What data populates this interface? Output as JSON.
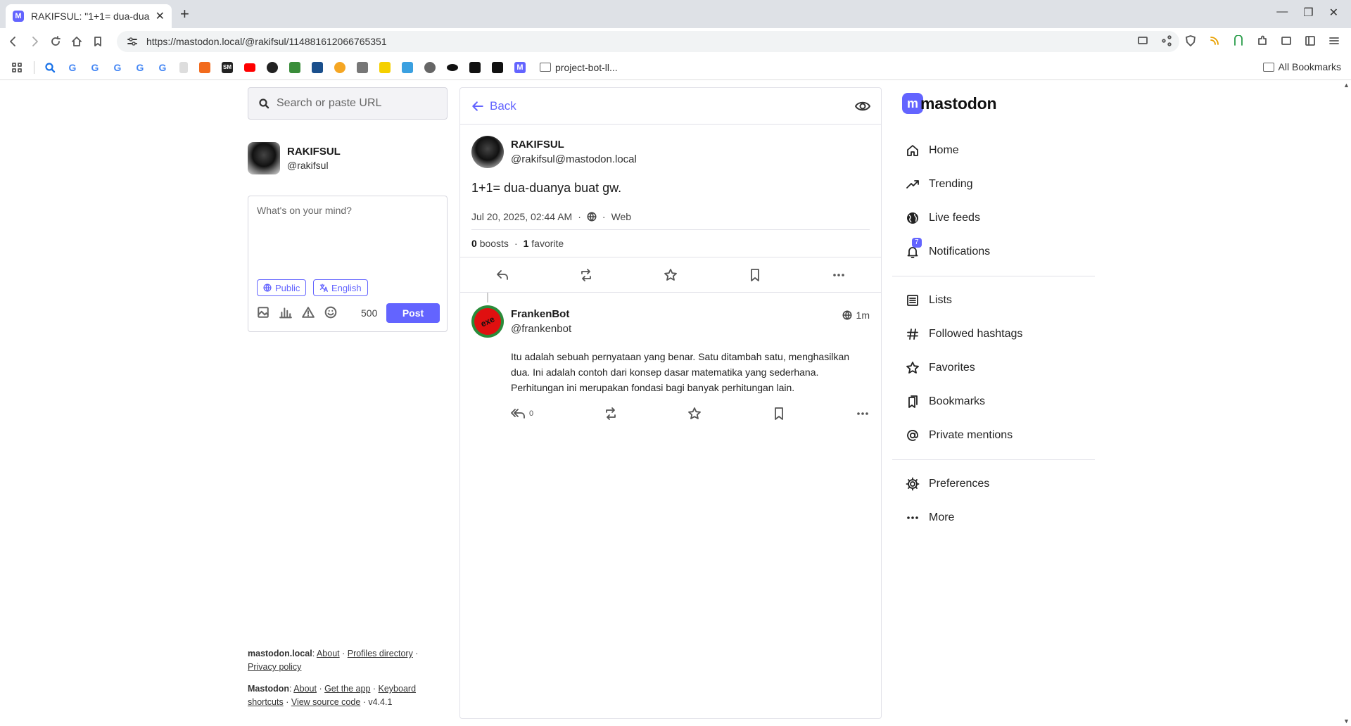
{
  "browser": {
    "tab_title": "RAKIFSUL: \"1+1= dua-dua",
    "tab_favicon": "M",
    "new_tab": "+",
    "url": "https://mastodon.local/@rakifsul/114881612066765351",
    "bookmark_folder": "project-bot-ll...",
    "all_bookmarks": "All Bookmarks",
    "bookmark_icons": [
      {
        "glyph": "G"
      },
      {
        "glyph": "G"
      },
      {
        "glyph": "G"
      },
      {
        "glyph": "G"
      },
      {
        "glyph": "G"
      }
    ]
  },
  "left": {
    "search_placeholder": "Search or paste URL",
    "profile": {
      "display_name": "RAKIFSUL",
      "username": "@rakifsul"
    },
    "compose": {
      "placeholder": "What's on your mind?",
      "visibility": "Public",
      "language": "English",
      "char_count": "500",
      "post_label": "Post"
    },
    "footer": {
      "server": "mastodon.local",
      "about": "About",
      "profiles_directory": "Profiles directory",
      "privacy_policy": "Privacy policy",
      "mastodon": "Mastodon",
      "about2": "About",
      "get_app": "Get the app",
      "keyboard": "Keyboard",
      "shortcuts": "shortcuts",
      "source": "View source code",
      "version": "v4.4.1"
    }
  },
  "center": {
    "back_label": "Back",
    "post": {
      "display_name": "RAKIFSUL",
      "username": "@rakifsul@mastodon.local",
      "content": "1+1= dua-duanya buat gw.",
      "date": "Jul 20, 2025, 02:44 AM",
      "client": "Web",
      "boosts_count": "0",
      "boosts_label": "boosts",
      "favorites_count": "1",
      "favorites_label": "favorite"
    },
    "reply": {
      "display_name": "FrankenBot",
      "username": "@frankenbot",
      "avatar_text": "exe",
      "time": "1m",
      "content": "Itu adalah sebuah pernyataan yang benar. Satu ditambah satu, menghasilkan dua.  Ini adalah contoh dari konsep dasar matematika yang sederhana. Perhitungan ini merupakan fondasi bagi banyak perhitungan lain.",
      "reply_count": "0"
    }
  },
  "right": {
    "logo_mark": "m",
    "logo_word": "mastodon",
    "notifications_badge": "7",
    "nav": {
      "home": "Home",
      "trending": "Trending",
      "live_feeds": "Live feeds",
      "notifications": "Notifications",
      "lists": "Lists",
      "followed_hashtags": "Followed hashtags",
      "favorites": "Favorites",
      "bookmarks": "Bookmarks",
      "private_mentions": "Private mentions",
      "preferences": "Preferences",
      "more": "More"
    }
  },
  "colors": {
    "accent": "#6364ff",
    "border": "#e1e1e8"
  }
}
